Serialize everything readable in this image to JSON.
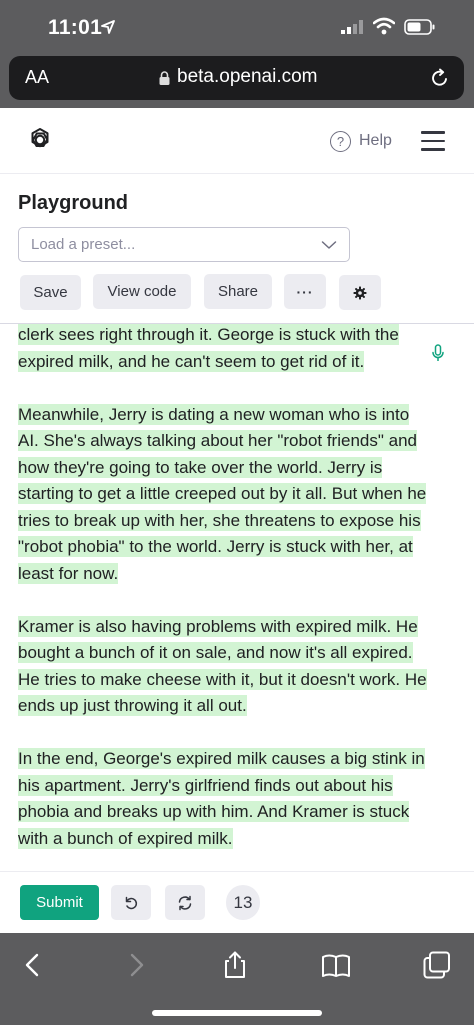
{
  "status_bar": {
    "time": "11:01"
  },
  "browser": {
    "aa_label": "AA",
    "url": "beta.openai.com"
  },
  "header": {
    "help_label": "Help"
  },
  "playground": {
    "title": "Playground",
    "preset_placeholder": "Load a preset...",
    "buttons": {
      "save": "Save",
      "view_code": "View code",
      "share": "Share",
      "more": "···"
    }
  },
  "content": {
    "paragraphs": [
      "clerk sees right through it. George is stuck with the expired milk, and he can't seem to get rid of it.",
      "Meanwhile, Jerry is dating a new woman who is into AI. She's always talking about her \"robot friends\" and how they're going to take over the world. Jerry is starting to get a little creeped out by it all. But when he tries to break up with her, she threatens to expose his \"robot phobia\" to the world. Jerry is stuck with her, at least for now.",
      "Kramer is also having problems with expired milk. He bought a bunch of it on sale, and now it's all expired. He tries to make cheese with it, but it doesn't work. He ends up just throwing it all out.",
      "In the end, George's expired milk causes a big stink in his apartment. Jerry's girlfriend finds out about his phobia and breaks up with him. And Kramer is stuck with a bunch of expired milk."
    ],
    "highlight_color": "#d2f4d3"
  },
  "footer": {
    "submit_label": "Submit",
    "token_count": "13"
  },
  "colors": {
    "accent": "#10a37f",
    "chrome": "#5c5c5e"
  }
}
